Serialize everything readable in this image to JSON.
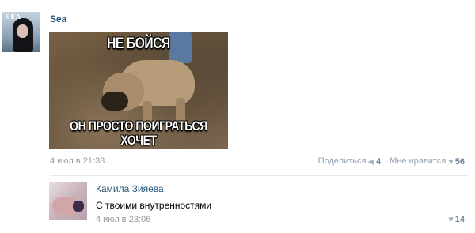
{
  "post": {
    "author": "Sea",
    "image": {
      "caption_top": "НЕ БОЙСЯ",
      "caption_bottom_line1": "ОН ПРОСТО ПОИГРАТЬСЯ",
      "caption_bottom_line2": "ХОЧЕТ"
    },
    "date": "4 июл в 21:38",
    "actions": {
      "share_label": "Поделиться",
      "share_count": "4",
      "like_label": "Мне нравится",
      "like_count": "56"
    }
  },
  "comment": {
    "author": "Камила Зияева",
    "text": "С твоими внутренностями",
    "date": "4 июл в 23:06",
    "like_count": "14"
  },
  "icons": {
    "share": "megaphone-icon",
    "like": "heart-icon"
  },
  "colors": {
    "link": "#2b587a",
    "muted": "#999999",
    "action": "#93a3b5"
  }
}
